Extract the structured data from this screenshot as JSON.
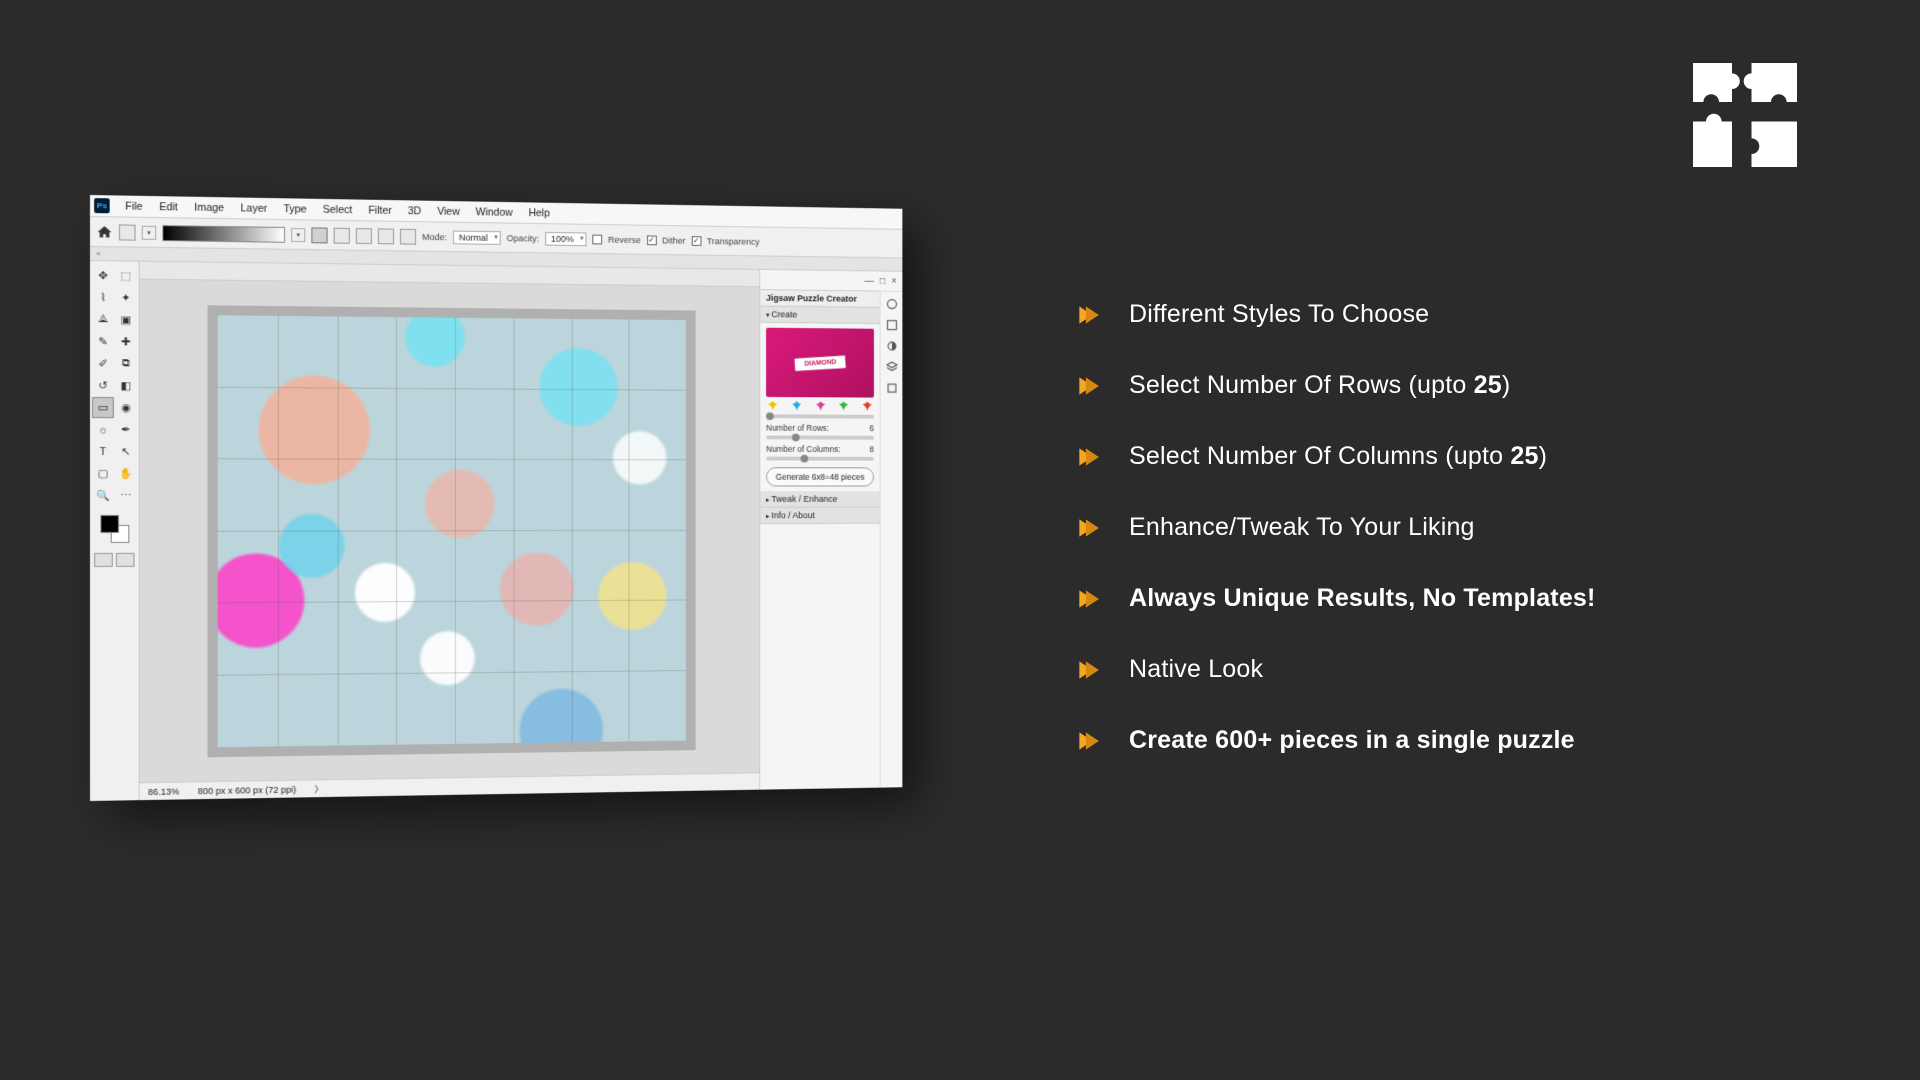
{
  "logo": {
    "alt": "Jigsaw puzzle logo"
  },
  "features": [
    {
      "text": "Different Styles To Choose",
      "bold": false
    },
    {
      "text": "Select Number Of Rows (upto ",
      "boldPart": "25",
      "tail": ")"
    },
    {
      "text": "Select Number Of Columns  (upto ",
      "boldPart": "25",
      "tail": ")"
    },
    {
      "text": "Enhance/Tweak To Your Liking",
      "bold": false
    },
    {
      "text": "Always Unique Results, No Templates!",
      "bold": true
    },
    {
      "text": "Native Look",
      "bold": false
    },
    {
      "text": "Create 600+ pieces in a single puzzle",
      "bold": true
    }
  ],
  "ps": {
    "appBadge": "Ps",
    "menu": [
      "File",
      "Edit",
      "Image",
      "Layer",
      "Type",
      "Select",
      "Filter",
      "3D",
      "View",
      "Window",
      "Help"
    ],
    "optbar": {
      "modeLabel": "Mode:",
      "modeValue": "Normal",
      "opacityLabel": "Opacity:",
      "opacityValue": "100%",
      "reverse": "Reverse",
      "dither": "Dither",
      "transparency": "Transparency"
    },
    "expandChevrons": "«",
    "status": {
      "zoom": "86.13%",
      "docinfo": "800 px x 600 px (72 ppi)",
      "caret": "〉"
    },
    "docControls": {
      "min": "—",
      "max": "□",
      "close": "×"
    },
    "panel": {
      "title": "Jigsaw Puzzle Creator",
      "create": "Create",
      "styleName": "DIAMOND",
      "rowsLabel": "Number of Rows:",
      "rowsValue": "6",
      "colsLabel": "Number of Columns:",
      "colsValue": "8",
      "generate": "Generate 6x8=48 pieces",
      "tweak": "Tweak / Enhance",
      "info": "Info / About"
    }
  }
}
